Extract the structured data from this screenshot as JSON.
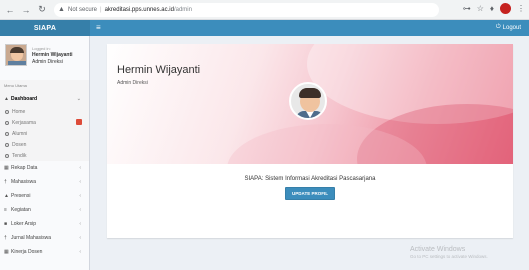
{
  "browser": {
    "not_secure_label": "Not secure",
    "url_host": "akreditasi.pps.unnes.ac.id",
    "url_path": "/admin"
  },
  "app": {
    "logo": "SIAPA",
    "logout_label": "Logout"
  },
  "sidebar": {
    "logged_label": "Logged in:",
    "user_name": "Hermin Wijayanti",
    "user_role": "Admin Direksi",
    "menu_header": "Menu Utama",
    "dashboard": {
      "label": "Dashboard",
      "sub_items": [
        {
          "label": "Home"
        },
        {
          "label": "Kerjasama"
        },
        {
          "label": "Alumni"
        },
        {
          "label": "Dosen"
        },
        {
          "label": "Tendik"
        }
      ]
    },
    "items": [
      {
        "label": "Rekap Data",
        "icon": "table-icon"
      },
      {
        "label": "Mahasiswa",
        "icon": "user-icon"
      },
      {
        "label": "Presensi",
        "icon": "user-icon"
      },
      {
        "label": "Kegiatan",
        "icon": "list-icon"
      },
      {
        "label": "Loker Arsip",
        "icon": "folder-icon"
      },
      {
        "label": "Jurnal Mahasiswa",
        "icon": "user-icon"
      },
      {
        "label": "Kinerja Dosen",
        "icon": "table-icon"
      }
    ]
  },
  "profile": {
    "name": "Hermin Wijayanti",
    "role": "Admin Direksi",
    "system_title": "SIAPA: Sistem Informasi Akreditasi Pascasarjana",
    "update_button": "UPDATE PROFIL"
  },
  "watermark": {
    "title": "Activate Windows",
    "subtitle": "Go to PC settings to activate Windows."
  }
}
